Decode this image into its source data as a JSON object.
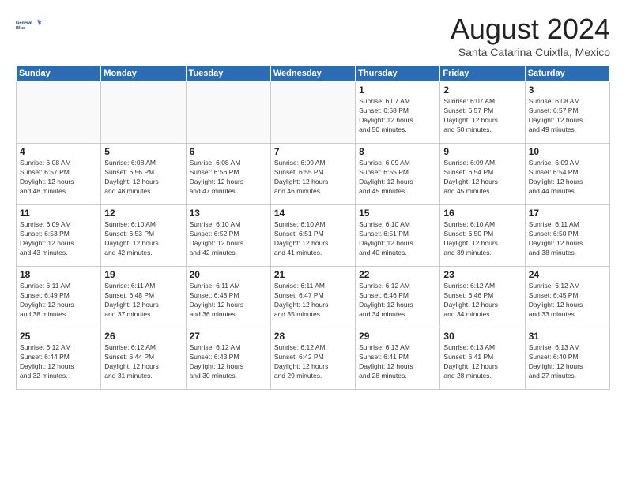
{
  "header": {
    "logo_line1": "General",
    "logo_line2": "Blue",
    "month_title": "August 2024",
    "subtitle": "Santa Catarina Cuixtla, Mexico"
  },
  "days_of_week": [
    "Sunday",
    "Monday",
    "Tuesday",
    "Wednesday",
    "Thursday",
    "Friday",
    "Saturday"
  ],
  "weeks": [
    [
      {
        "day": "",
        "info": ""
      },
      {
        "day": "",
        "info": ""
      },
      {
        "day": "",
        "info": ""
      },
      {
        "day": "",
        "info": ""
      },
      {
        "day": "1",
        "info": "Sunrise: 6:07 AM\nSunset: 6:58 PM\nDaylight: 12 hours\nand 50 minutes."
      },
      {
        "day": "2",
        "info": "Sunrise: 6:07 AM\nSunset: 6:57 PM\nDaylight: 12 hours\nand 50 minutes."
      },
      {
        "day": "3",
        "info": "Sunrise: 6:08 AM\nSunset: 6:57 PM\nDaylight: 12 hours\nand 49 minutes."
      }
    ],
    [
      {
        "day": "4",
        "info": "Sunrise: 6:08 AM\nSunset: 6:57 PM\nDaylight: 12 hours\nand 48 minutes."
      },
      {
        "day": "5",
        "info": "Sunrise: 6:08 AM\nSunset: 6:56 PM\nDaylight: 12 hours\nand 48 minutes."
      },
      {
        "day": "6",
        "info": "Sunrise: 6:08 AM\nSunset: 6:56 PM\nDaylight: 12 hours\nand 47 minutes."
      },
      {
        "day": "7",
        "info": "Sunrise: 6:09 AM\nSunset: 6:55 PM\nDaylight: 12 hours\nand 46 minutes."
      },
      {
        "day": "8",
        "info": "Sunrise: 6:09 AM\nSunset: 6:55 PM\nDaylight: 12 hours\nand 45 minutes."
      },
      {
        "day": "9",
        "info": "Sunrise: 6:09 AM\nSunset: 6:54 PM\nDaylight: 12 hours\nand 45 minutes."
      },
      {
        "day": "10",
        "info": "Sunrise: 6:09 AM\nSunset: 6:54 PM\nDaylight: 12 hours\nand 44 minutes."
      }
    ],
    [
      {
        "day": "11",
        "info": "Sunrise: 6:09 AM\nSunset: 6:53 PM\nDaylight: 12 hours\nand 43 minutes."
      },
      {
        "day": "12",
        "info": "Sunrise: 6:10 AM\nSunset: 6:53 PM\nDaylight: 12 hours\nand 42 minutes."
      },
      {
        "day": "13",
        "info": "Sunrise: 6:10 AM\nSunset: 6:52 PM\nDaylight: 12 hours\nand 42 minutes."
      },
      {
        "day": "14",
        "info": "Sunrise: 6:10 AM\nSunset: 6:51 PM\nDaylight: 12 hours\nand 41 minutes."
      },
      {
        "day": "15",
        "info": "Sunrise: 6:10 AM\nSunset: 6:51 PM\nDaylight: 12 hours\nand 40 minutes."
      },
      {
        "day": "16",
        "info": "Sunrise: 6:10 AM\nSunset: 6:50 PM\nDaylight: 12 hours\nand 39 minutes."
      },
      {
        "day": "17",
        "info": "Sunrise: 6:11 AM\nSunset: 6:50 PM\nDaylight: 12 hours\nand 38 minutes."
      }
    ],
    [
      {
        "day": "18",
        "info": "Sunrise: 6:11 AM\nSunset: 6:49 PM\nDaylight: 12 hours\nand 38 minutes."
      },
      {
        "day": "19",
        "info": "Sunrise: 6:11 AM\nSunset: 6:48 PM\nDaylight: 12 hours\nand 37 minutes."
      },
      {
        "day": "20",
        "info": "Sunrise: 6:11 AM\nSunset: 6:48 PM\nDaylight: 12 hours\nand 36 minutes."
      },
      {
        "day": "21",
        "info": "Sunrise: 6:11 AM\nSunset: 6:47 PM\nDaylight: 12 hours\nand 35 minutes."
      },
      {
        "day": "22",
        "info": "Sunrise: 6:12 AM\nSunset: 6:46 PM\nDaylight: 12 hours\nand 34 minutes."
      },
      {
        "day": "23",
        "info": "Sunrise: 6:12 AM\nSunset: 6:46 PM\nDaylight: 12 hours\nand 34 minutes."
      },
      {
        "day": "24",
        "info": "Sunrise: 6:12 AM\nSunset: 6:45 PM\nDaylight: 12 hours\nand 33 minutes."
      }
    ],
    [
      {
        "day": "25",
        "info": "Sunrise: 6:12 AM\nSunset: 6:44 PM\nDaylight: 12 hours\nand 32 minutes."
      },
      {
        "day": "26",
        "info": "Sunrise: 6:12 AM\nSunset: 6:44 PM\nDaylight: 12 hours\nand 31 minutes."
      },
      {
        "day": "27",
        "info": "Sunrise: 6:12 AM\nSunset: 6:43 PM\nDaylight: 12 hours\nand 30 minutes."
      },
      {
        "day": "28",
        "info": "Sunrise: 6:12 AM\nSunset: 6:42 PM\nDaylight: 12 hours\nand 29 minutes."
      },
      {
        "day": "29",
        "info": "Sunrise: 6:13 AM\nSunset: 6:41 PM\nDaylight: 12 hours\nand 28 minutes."
      },
      {
        "day": "30",
        "info": "Sunrise: 6:13 AM\nSunset: 6:41 PM\nDaylight: 12 hours\nand 28 minutes."
      },
      {
        "day": "31",
        "info": "Sunrise: 6:13 AM\nSunset: 6:40 PM\nDaylight: 12 hours\nand 27 minutes."
      }
    ]
  ]
}
